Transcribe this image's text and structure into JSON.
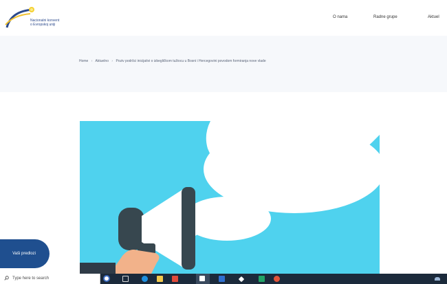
{
  "header": {
    "logo_text": "Nacionalni konvent\no Evropskoj uniji",
    "nav": [
      {
        "label": "O nama"
      },
      {
        "label": "Radne grupe"
      },
      {
        "label": "Aktuel"
      }
    ]
  },
  "breadcrumb": {
    "items": [
      "Home",
      "Aktuelno",
      "Poziv podršci inicijativi o izbegličkom tužiocu u Bosni i Hercegovini povodom formiranja nove vlade"
    ],
    "separator": "›"
  },
  "float_button": {
    "label": "Vaši predlozi"
  },
  "taskbar": {
    "search_placeholder": "Type here to search"
  },
  "colors": {
    "hero_background": "#4fd2ee",
    "float_button": "#1f4f8f",
    "taskbar": "#1b2a3b"
  }
}
